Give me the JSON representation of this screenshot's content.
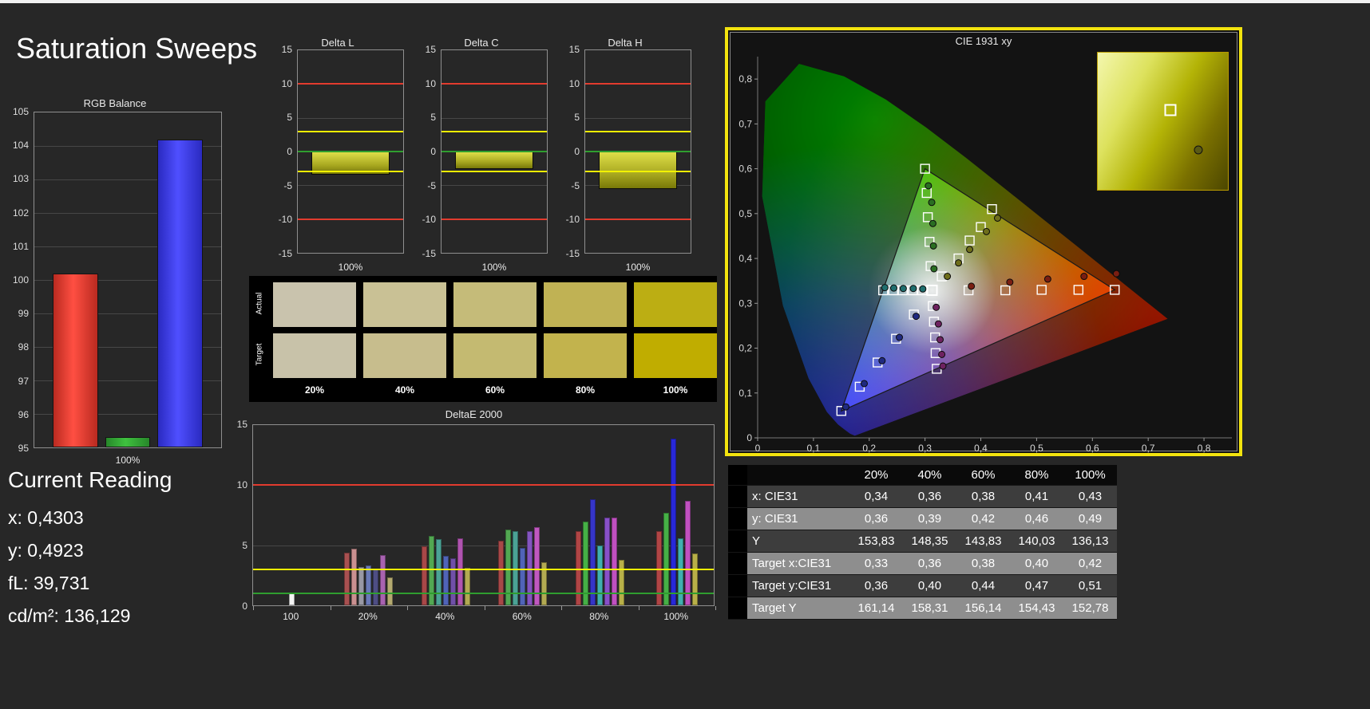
{
  "page": {
    "title": "Saturation Sweeps",
    "background": "#272727",
    "top_strip_color": "#f2f2f2",
    "selected_panel_border": "#f2e30e"
  },
  "current_reading": {
    "heading": "Current Reading",
    "lines": [
      "x: 0,4303",
      "y: 0,4923",
      "fL: 39,731",
      "cd/m²: 136,129"
    ]
  },
  "swatches": {
    "row_labels": [
      "Actual",
      "Target"
    ],
    "column_labels": [
      "20%",
      "40%",
      "60%",
      "80%",
      "100%"
    ],
    "actual": [
      "#c9c3ad",
      "#c9c195",
      "#c5bb79",
      "#c0b254",
      "#bcae13"
    ],
    "target": [
      "#c8c2a9",
      "#c7bd8d",
      "#c4ba71",
      "#c2b34d",
      "#c0ad00"
    ]
  },
  "results_table": {
    "columns": [
      "",
      "20%",
      "40%",
      "60%",
      "80%",
      "100%"
    ],
    "rows": [
      {
        "label": "x: CIE31",
        "values": [
          "0,34",
          "0,36",
          "0,38",
          "0,41",
          "0,43"
        ]
      },
      {
        "label": "y: CIE31",
        "values": [
          "0,36",
          "0,39",
          "0,42",
          "0,46",
          "0,49"
        ]
      },
      {
        "label": "Y",
        "values": [
          "153,83",
          "148,35",
          "143,83",
          "140,03",
          "136,13"
        ]
      },
      {
        "label": "Target x:CIE31",
        "values": [
          "0,33",
          "0,36",
          "0,38",
          "0,40",
          "0,42"
        ]
      },
      {
        "label": "Target y:CIE31",
        "values": [
          "0,36",
          "0,40",
          "0,44",
          "0,47",
          "0,51"
        ]
      },
      {
        "label": "Target Y",
        "values": [
          "161,14",
          "158,31",
          "156,14",
          "154,43",
          "152,78"
        ]
      }
    ]
  },
  "cie_inset": {
    "markers": [
      {
        "shape": "square",
        "x": 56,
        "y": 42
      },
      {
        "shape": "circle",
        "x": 77,
        "y": 71
      }
    ]
  },
  "chart_data": [
    {
      "id": "rgb-balance",
      "type": "bar",
      "title": "RGB Balance",
      "categories": [
        "Red",
        "Green",
        "Blue"
      ],
      "values": [
        100.2,
        95.3,
        104.2
      ],
      "colors": [
        "#ff4f42",
        "#3fc13f",
        "#4f4fff"
      ],
      "colors_edge": [
        "#b92a20",
        "#27872a",
        "#2a2ac0"
      ],
      "ylim": [
        95,
        105
      ],
      "yticks": [
        95,
        96,
        97,
        98,
        99,
        100,
        101,
        102,
        103,
        104,
        105
      ],
      "gridlines": [
        96,
        97,
        98,
        99,
        100,
        101,
        102,
        103,
        104
      ],
      "xlabel": "100%"
    },
    {
      "id": "delta-l",
      "type": "bar",
      "title": "Delta L",
      "categories": [
        "100%"
      ],
      "values": [
        -3.4
      ],
      "ylim": [
        -15,
        15
      ],
      "yticks": [
        -15,
        -10,
        -5,
        0,
        5,
        10,
        15
      ],
      "gridlines": [
        -5,
        5
      ],
      "ref_lines": [
        {
          "y": 10,
          "color": "#e23b2e"
        },
        {
          "y": 3,
          "color": "#f2f200"
        },
        {
          "y": 0,
          "color": "#2f9e2f"
        },
        {
          "y": -3,
          "color": "#f2f200"
        },
        {
          "y": -10,
          "color": "#e23b2e"
        }
      ],
      "xlabel": "100%"
    },
    {
      "id": "delta-c",
      "type": "bar",
      "title": "Delta C",
      "categories": [
        "100%"
      ],
      "values": [
        -2.6
      ],
      "ylim": [
        -15,
        15
      ],
      "yticks": [
        -15,
        -10,
        -5,
        0,
        5,
        10,
        15
      ],
      "gridlines": [
        -5,
        5
      ],
      "ref_lines": [
        {
          "y": 10,
          "color": "#e23b2e"
        },
        {
          "y": 3,
          "color": "#f2f200"
        },
        {
          "y": 0,
          "color": "#2f9e2f"
        },
        {
          "y": -3,
          "color": "#f2f200"
        },
        {
          "y": -10,
          "color": "#e23b2e"
        }
      ],
      "xlabel": "100%"
    },
    {
      "id": "delta-h",
      "type": "bar",
      "title": "Delta H",
      "categories": [
        "100%"
      ],
      "values": [
        -5.5
      ],
      "ylim": [
        -15,
        15
      ],
      "yticks": [
        -15,
        -10,
        -5,
        0,
        5,
        10,
        15
      ],
      "gridlines": [
        -5,
        5
      ],
      "ref_lines": [
        {
          "y": 10,
          "color": "#e23b2e"
        },
        {
          "y": 3,
          "color": "#f2f200"
        },
        {
          "y": 0,
          "color": "#2f9e2f"
        },
        {
          "y": -3,
          "color": "#f2f200"
        },
        {
          "y": -10,
          "color": "#e23b2e"
        }
      ],
      "xlabel": "100%"
    },
    {
      "id": "deltae2000",
      "type": "bar",
      "title": "DeltaE 2000",
      "ylim": [
        0,
        15
      ],
      "yticks": [
        0,
        5,
        10,
        15
      ],
      "gridlines": [
        5
      ],
      "ref_lines": [
        {
          "y": 10,
          "color": "#e23b2e"
        },
        {
          "y": 3,
          "color": "#f2f200"
        },
        {
          "y": 1,
          "color": "#2f9e2f"
        }
      ],
      "groups": [
        {
          "label": "100",
          "bars": [
            {
              "color": "#f5f5f5",
              "value": 1.0
            }
          ]
        },
        {
          "label": "20%",
          "bars": [
            {
              "color": "#a85050",
              "value": 4.4
            },
            {
              "color": "#c99090",
              "value": 4.7
            },
            {
              "color": "#9898a4",
              "value": 3.2
            },
            {
              "color": "#6a7ab8",
              "value": 3.3
            },
            {
              "color": "#4e4e84",
              "value": 3.0
            },
            {
              "color": "#a862b0",
              "value": 4.2
            },
            {
              "color": "#b4aa70",
              "value": 2.3
            }
          ]
        },
        {
          "label": "40%",
          "bars": [
            {
              "color": "#a84848",
              "value": 4.9
            },
            {
              "color": "#52a852",
              "value": 5.8
            },
            {
              "color": "#4ba295",
              "value": 5.5
            },
            {
              "color": "#5064b8",
              "value": 4.1
            },
            {
              "color": "#7050a8",
              "value": 3.9
            },
            {
              "color": "#b054b0",
              "value": 5.6
            },
            {
              "color": "#b2aa52",
              "value": 3.1
            }
          ]
        },
        {
          "label": "60%",
          "bars": [
            {
              "color": "#a84848",
              "value": 5.4
            },
            {
              "color": "#52a852",
              "value": 6.3
            },
            {
              "color": "#4ba295",
              "value": 6.2
            },
            {
              "color": "#5064b8",
              "value": 4.8
            },
            {
              "color": "#8455c0",
              "value": 6.2
            },
            {
              "color": "#c058c0",
              "value": 6.5
            },
            {
              "color": "#b2aa52",
              "value": 3.6
            }
          ]
        },
        {
          "label": "80%",
          "bars": [
            {
              "color": "#b04545",
              "value": 6.2
            },
            {
              "color": "#46b046",
              "value": 7.0
            },
            {
              "color": "#3535c8",
              "value": 8.8
            },
            {
              "color": "#40b0b0",
              "value": 5.0
            },
            {
              "color": "#8850c8",
              "value": 7.3
            },
            {
              "color": "#c050c0",
              "value": 7.3
            },
            {
              "color": "#b8b048",
              "value": 3.8
            }
          ]
        },
        {
          "label": "100%",
          "bars": [
            {
              "color": "#b04545",
              "value": 6.2
            },
            {
              "color": "#46b046",
              "value": 7.7
            },
            {
              "color": "#2828d8",
              "value": 13.9
            },
            {
              "color": "#40b0b0",
              "value": 5.6
            },
            {
              "color": "#c050c0",
              "value": 8.7
            },
            {
              "color": "#b8b048",
              "value": 4.3
            }
          ]
        }
      ]
    },
    {
      "id": "cie-1931",
      "type": "scatter",
      "title": "CIE 1931 xy",
      "xlim": [
        0,
        0.85
      ],
      "ylim": [
        0,
        0.85
      ],
      "xticks": [
        "0",
        "0,1",
        "0,2",
        "0,3",
        "0,4",
        "0,5",
        "0,6",
        "0,7",
        "0,8"
      ],
      "yticks": [
        "0",
        "0,1",
        "0,2",
        "0,3",
        "0,4",
        "0,5",
        "0,6",
        "0,7",
        "0,8"
      ],
      "highlight_border": "#f2e30e",
      "gamut_triangle": {
        "red": [
          0.64,
          0.33
        ],
        "green": [
          0.3,
          0.6
        ],
        "blue": [
          0.15,
          0.06
        ]
      },
      "white_point": [
        0.3127,
        0.329
      ],
      "sweeps": [
        {
          "name": "red",
          "dot_color": "#7a1e12",
          "targets": [
            [
              0.378,
              0.329
            ],
            [
              0.444,
              0.329
            ],
            [
              0.509,
              0.33
            ],
            [
              0.575,
              0.33
            ],
            [
              0.64,
              0.33
            ]
          ],
          "measured": [
            [
              0.383,
              0.338
            ],
            [
              0.452,
              0.347
            ],
            [
              0.52,
              0.354
            ],
            [
              0.585,
              0.36
            ],
            [
              0.643,
              0.366
            ]
          ]
        },
        {
          "name": "green",
          "dot_color": "#2a6e22",
          "targets": [
            [
              0.31,
              0.383
            ],
            [
              0.308,
              0.437
            ],
            [
              0.305,
              0.492
            ],
            [
              0.303,
              0.546
            ],
            [
              0.3,
              0.6
            ]
          ],
          "measured": [
            [
              0.316,
              0.377
            ],
            [
              0.315,
              0.428
            ],
            [
              0.314,
              0.478
            ],
            [
              0.312,
              0.525
            ],
            [
              0.306,
              0.562
            ]
          ]
        },
        {
          "name": "blue",
          "dot_color": "#202a80",
          "targets": [
            [
              0.28,
              0.275
            ],
            [
              0.248,
              0.221
            ],
            [
              0.215,
              0.168
            ],
            [
              0.183,
              0.114
            ],
            [
              0.15,
              0.06
            ]
          ],
          "measured": [
            [
              0.284,
              0.271
            ],
            [
              0.254,
              0.224
            ],
            [
              0.223,
              0.172
            ],
            [
              0.191,
              0.121
            ],
            [
              0.158,
              0.069
            ]
          ]
        },
        {
          "name": "cyan",
          "dot_color": "#1f6e6e",
          "targets": [
            [
              0.295,
              0.329
            ],
            [
              0.278,
              0.329
            ],
            [
              0.26,
              0.329
            ],
            [
              0.243,
              0.329
            ],
            [
              0.225,
              0.329
            ]
          ],
          "measured": [
            [
              0.296,
              0.332
            ],
            [
              0.279,
              0.333
            ],
            [
              0.261,
              0.333
            ],
            [
              0.244,
              0.334
            ],
            [
              0.228,
              0.335
            ]
          ]
        },
        {
          "name": "magenta",
          "dot_color": "#6e2260",
          "targets": [
            [
              0.314,
              0.294
            ],
            [
              0.316,
              0.259
            ],
            [
              0.318,
              0.224
            ],
            [
              0.319,
              0.189
            ],
            [
              0.321,
              0.154
            ]
          ],
          "measured": [
            [
              0.32,
              0.291
            ],
            [
              0.324,
              0.254
            ],
            [
              0.327,
              0.219
            ],
            [
              0.33,
              0.186
            ],
            [
              0.332,
              0.16
            ]
          ]
        },
        {
          "name": "yellow",
          "dot_color": "#6e6e1a",
          "targets": [
            [
              0.33,
              0.36
            ],
            [
              0.36,
              0.4
            ],
            [
              0.38,
              0.44
            ],
            [
              0.4,
              0.47
            ],
            [
              0.42,
              0.51
            ]
          ],
          "measured": [
            [
              0.34,
              0.36
            ],
            [
              0.36,
              0.39
            ],
            [
              0.38,
              0.42
            ],
            [
              0.41,
              0.46
            ],
            [
              0.43,
              0.49
            ]
          ]
        }
      ]
    }
  ]
}
